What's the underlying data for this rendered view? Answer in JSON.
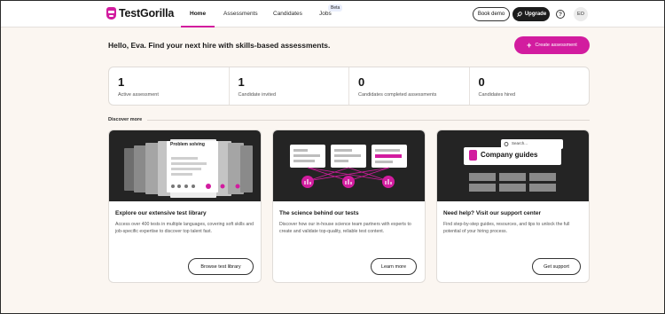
{
  "brand": {
    "name": "TestGorilla",
    "accent": "#d21c9f"
  },
  "nav": {
    "items": [
      {
        "label": "Home",
        "active": true
      },
      {
        "label": "Assessments",
        "active": false
      },
      {
        "label": "Candidates",
        "active": false
      },
      {
        "label": "Jobs",
        "active": false
      }
    ],
    "beta_badge": "Beta",
    "book_demo": "Book demo",
    "upgrade": "Upgrade",
    "avatar_initials": "EO"
  },
  "greeting": "Hello, Eva. Find your next hire with skills-based assessments.",
  "create_button": "Create assessment",
  "stats": [
    {
      "value": "1",
      "label": "Active assessment"
    },
    {
      "value": "1",
      "label": "Candidate invited"
    },
    {
      "value": "0",
      "label": "Candidates completed assessments"
    },
    {
      "value": "0",
      "label": "Candidates hired"
    }
  ],
  "discover_label": "Discover more",
  "cards": [
    {
      "title": "Explore our extensive test library",
      "description": "Access over 400 tests in multiple languages, covering soft skills and job-specific expertise to discover top talent fast.",
      "button": "Browse test library",
      "illustration_text": "Problem solving"
    },
    {
      "title": "The science behind our tests",
      "description": "Discover how our in-house science team partners with experts to create and validate top-quality, reliable test content.",
      "button": "Learn more"
    },
    {
      "title": "Need help? Visit our support center",
      "description": "Find step-by-step guides, resources, and tips to unlock the full potential of your hiring process.",
      "button": "Get support",
      "illustration_search": "Search...",
      "illustration_text": "Company guides"
    }
  ]
}
